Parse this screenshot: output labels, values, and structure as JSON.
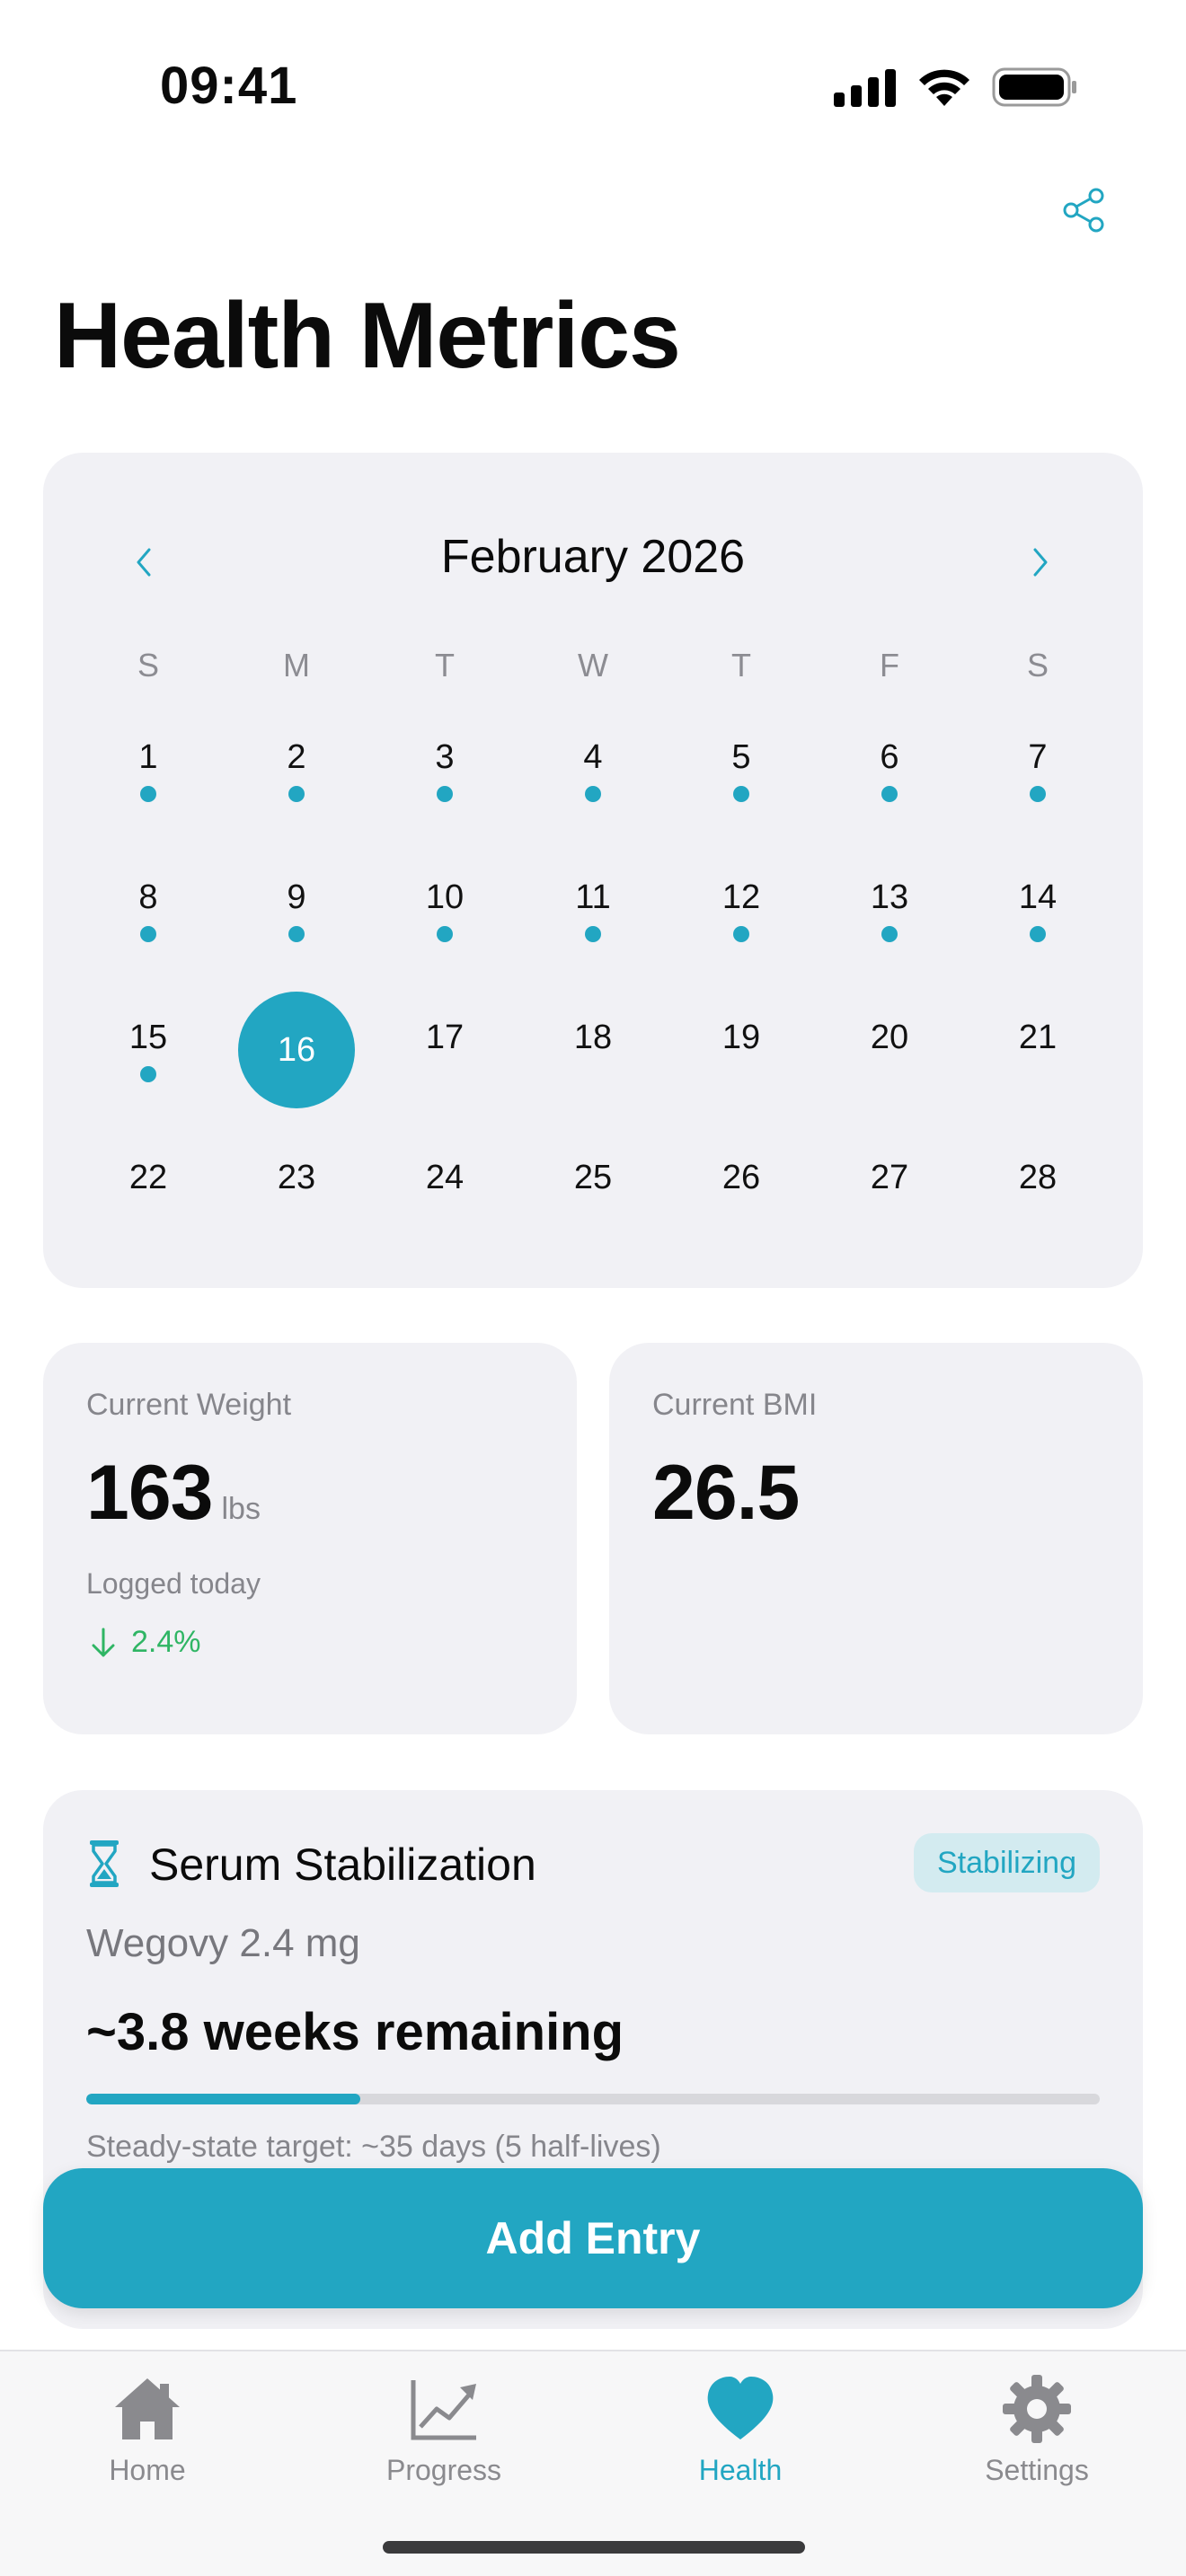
{
  "status_bar": {
    "time": "09:41",
    "icons": [
      "signal-icon",
      "wifi-icon",
      "battery-icon"
    ]
  },
  "header": {
    "title": "Health Metrics",
    "share_icon": "share-icon"
  },
  "calendar": {
    "month": "February 2026",
    "weekdays": [
      "S",
      "M",
      "T",
      "W",
      "T",
      "F",
      "S"
    ],
    "weeks": [
      [
        {
          "d": "1",
          "dot": true
        },
        {
          "d": "2",
          "dot": true
        },
        {
          "d": "3",
          "dot": true
        },
        {
          "d": "4",
          "dot": true
        },
        {
          "d": "5",
          "dot": true
        },
        {
          "d": "6",
          "dot": true
        },
        {
          "d": "7",
          "dot": true
        }
      ],
      [
        {
          "d": "8",
          "dot": true
        },
        {
          "d": "9",
          "dot": true
        },
        {
          "d": "10",
          "dot": true
        },
        {
          "d": "11",
          "dot": true
        },
        {
          "d": "12",
          "dot": true
        },
        {
          "d": "13",
          "dot": true
        },
        {
          "d": "14",
          "dot": true
        }
      ],
      [
        {
          "d": "15",
          "dot": true
        },
        {
          "d": "16",
          "dot": false,
          "selected": true
        },
        {
          "d": "17",
          "dot": false
        },
        {
          "d": "18",
          "dot": false
        },
        {
          "d": "19",
          "dot": false
        },
        {
          "d": "20",
          "dot": false
        },
        {
          "d": "21",
          "dot": false
        }
      ],
      [
        {
          "d": "22",
          "dot": false
        },
        {
          "d": "23",
          "dot": false
        },
        {
          "d": "24",
          "dot": false
        },
        {
          "d": "25",
          "dot": false
        },
        {
          "d": "26",
          "dot": false
        },
        {
          "d": "27",
          "dot": false
        },
        {
          "d": "28",
          "dot": false
        }
      ]
    ]
  },
  "weight": {
    "label": "Current Weight",
    "value": "163",
    "unit": "lbs",
    "subtitle": "Logged today",
    "trend": "2.4%",
    "trend_direction": "down",
    "trend_color": "#2fb564"
  },
  "bmi": {
    "label": "Current BMI",
    "value": "26.5"
  },
  "serum": {
    "title": "Serum Stabilization",
    "badge": "Stabilizing",
    "drug": "Wegovy 2.4 mg",
    "remaining": "~3.8 weeks remaining",
    "progress": 0.27,
    "note": "Steady-state target: ~35 days (5 half-lives)"
  },
  "actions": {
    "add_entry": "Add Entry"
  },
  "tabs": [
    {
      "label": "Home",
      "icon": "house-icon",
      "active": false
    },
    {
      "label": "Progress",
      "icon": "chart-trend-icon",
      "active": false
    },
    {
      "label": "Health",
      "icon": "heart-icon",
      "active": true
    },
    {
      "label": "Settings",
      "icon": "gear-icon",
      "active": false
    }
  ],
  "colors": {
    "accent": "#22a6c2",
    "card_bg": "#f1f1f5",
    "positive": "#2fb564",
    "muted_text": "#86868c"
  }
}
